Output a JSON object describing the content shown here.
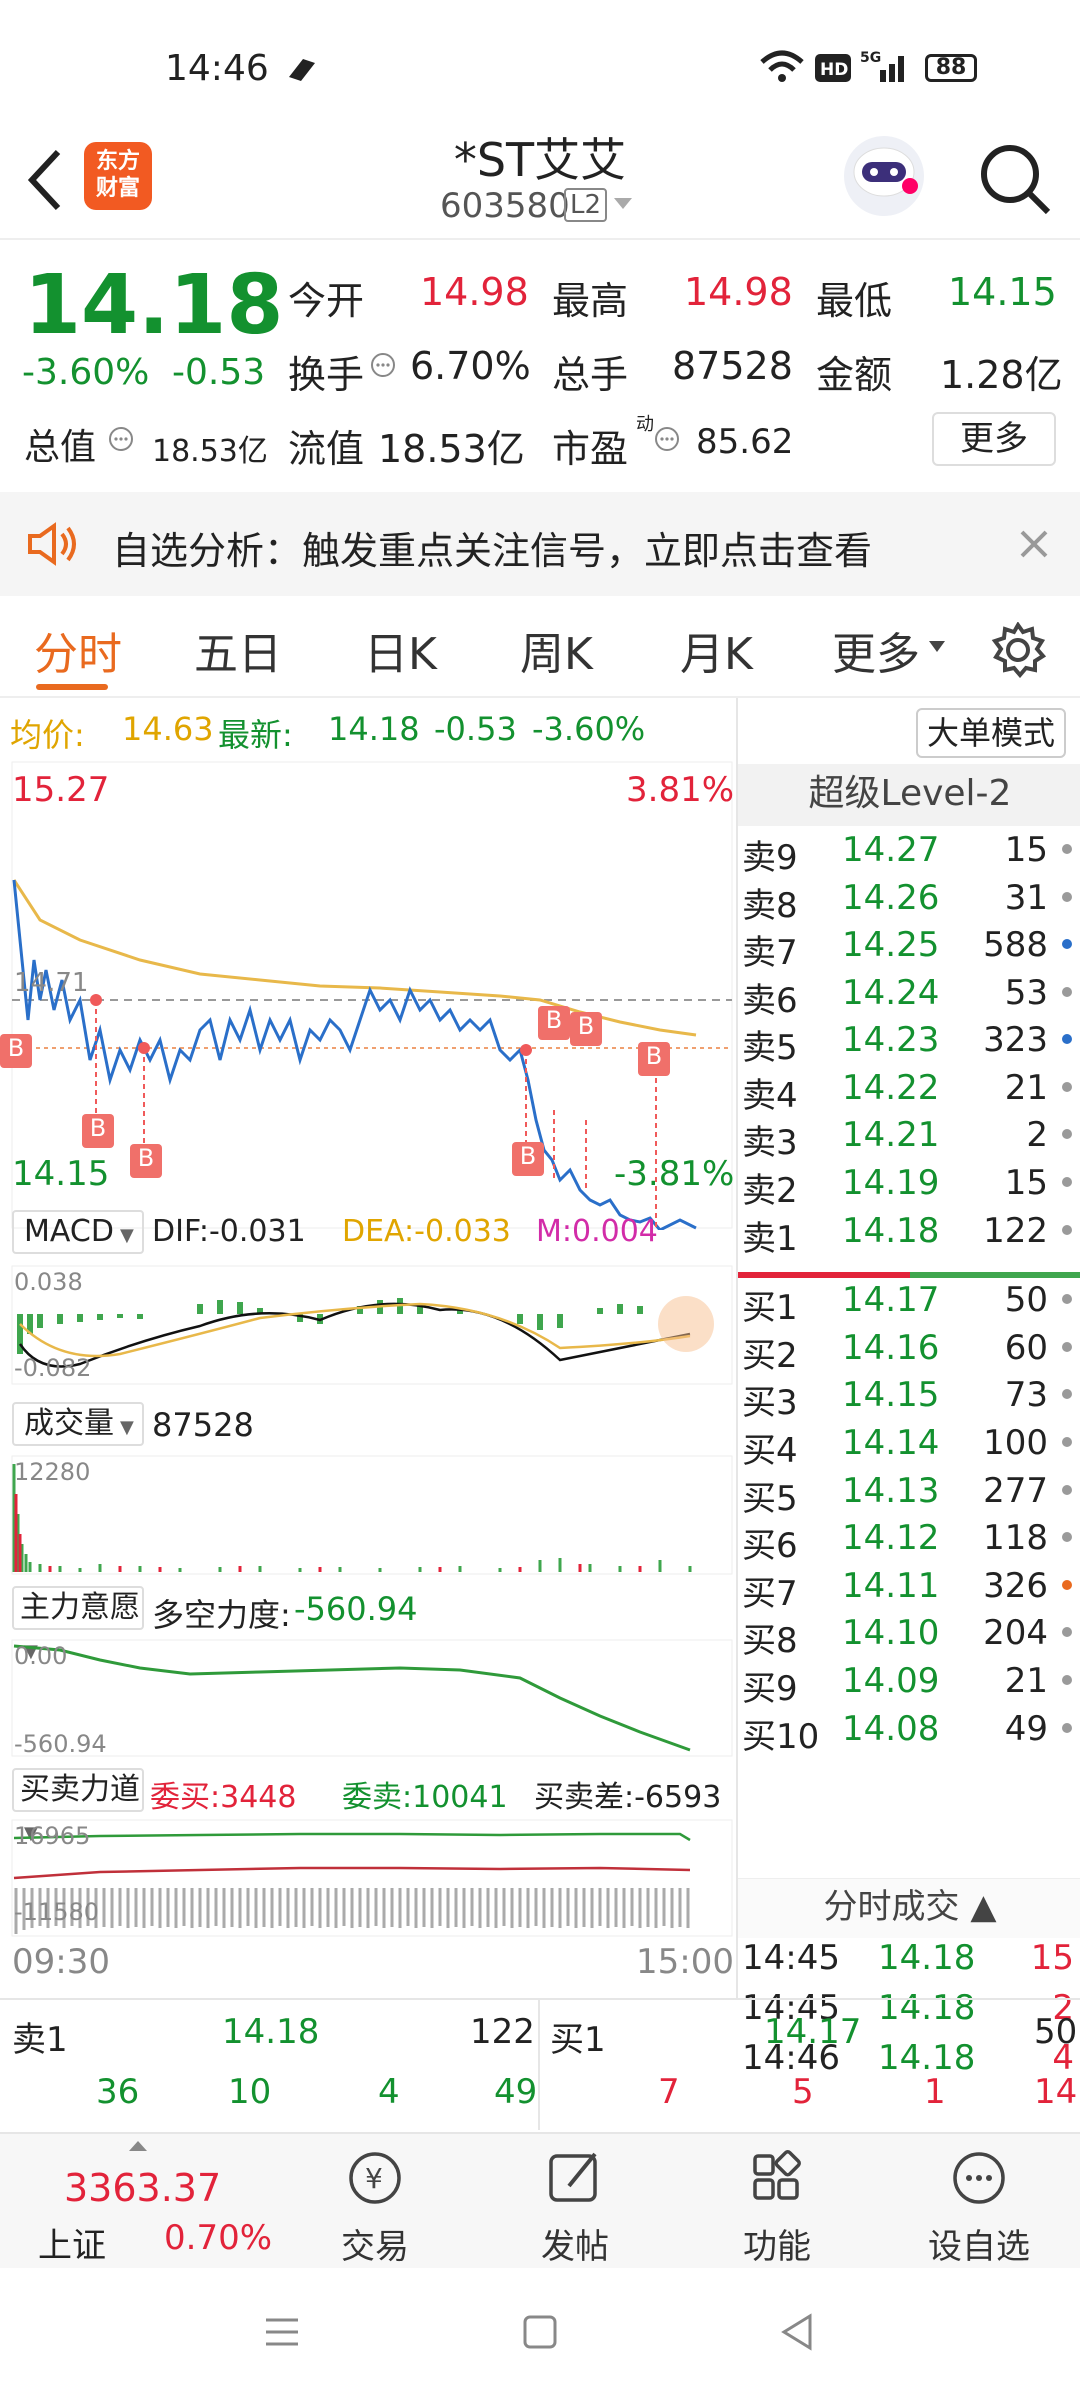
{
  "status_bar": {
    "time": "14:46",
    "battery": "88",
    "network": "5G"
  },
  "header": {
    "logo_line1": "东方",
    "logo_line2": "财富",
    "stock_name": "*ST艾艾",
    "stock_code": "603580",
    "level_badge": "L2"
  },
  "quote": {
    "price": "14.18",
    "change_pct": "-3.60%",
    "change_amt": "-0.53",
    "open_label": "今开",
    "open": "14.98",
    "high_label": "最高",
    "high": "14.98",
    "low_label": "最低",
    "low": "14.15",
    "turnover_label": "换手",
    "turnover": "6.70%",
    "volume_label": "总手",
    "volume": "87528",
    "amount_label": "金额",
    "amount": "1.28亿",
    "total_value_label": "总值",
    "total_value": "18.53亿",
    "float_value_label": "流值",
    "float_value": "18.53亿",
    "pe_label": "市盈",
    "pe_sup": "动",
    "pe": "85.62",
    "more_button": "更多"
  },
  "notice": {
    "text": "自选分析：触发重点关注信号，立即点击查看"
  },
  "tabs": [
    {
      "label": "分时"
    },
    {
      "label": "五日"
    },
    {
      "label": "日K"
    },
    {
      "label": "周K"
    },
    {
      "label": "月K"
    },
    {
      "label": "更多"
    }
  ],
  "chart_info": {
    "avg_label": "均价:",
    "avg": "14.63",
    "latest_label": "最新:",
    "latest": "14.18",
    "latest_change": "-0.53",
    "latest_pct": "-3.60%",
    "big_order_button": "大单模式"
  },
  "price_chart": {
    "top_price": "15.27",
    "top_pct": "3.81%",
    "bottom_price": "14.15",
    "bottom_pct": "-3.81%",
    "ref_price": "14.71"
  },
  "macd": {
    "label": "MACD",
    "dif": "DIF:-0.031",
    "dea": "DEA:-0.033",
    "m": "M:0.004",
    "top": "0.038",
    "bottom": "-0.082"
  },
  "volume_panel": {
    "label": "成交量",
    "value": "87528",
    "max": "12280"
  },
  "main_force": {
    "label": "主力意愿",
    "strength_label": "多空力度:",
    "strength": "-560.94",
    "top": "0.00",
    "bottom": "-560.94"
  },
  "buysell": {
    "label": "买卖力道",
    "buy": "委买:3448",
    "sell": "委卖:10041",
    "diff": "买卖差:-6593",
    "top": "16965",
    "bottom": "-11580"
  },
  "time_axis": {
    "start": "09:30",
    "end": "15:00"
  },
  "order_book": {
    "title": "超级Level-2",
    "sells": [
      {
        "label": "卖9",
        "price": "14.27",
        "vol": "15",
        "dot": "gray"
      },
      {
        "label": "卖8",
        "price": "14.26",
        "vol": "31",
        "dot": "gray"
      },
      {
        "label": "卖7",
        "price": "14.25",
        "vol": "588",
        "dot": "blue"
      },
      {
        "label": "卖6",
        "price": "14.24",
        "vol": "53",
        "dot": "gray"
      },
      {
        "label": "卖5",
        "price": "14.23",
        "vol": "323",
        "dot": "blue"
      },
      {
        "label": "卖4",
        "price": "14.22",
        "vol": "21",
        "dot": "gray"
      },
      {
        "label": "卖3",
        "price": "14.21",
        "vol": "2",
        "dot": "gray"
      },
      {
        "label": "卖2",
        "price": "14.19",
        "vol": "15",
        "dot": "gray"
      },
      {
        "label": "卖1",
        "price": "14.18",
        "vol": "122",
        "dot": "gray"
      }
    ],
    "buys": [
      {
        "label": "买1",
        "price": "14.17",
        "vol": "50",
        "dot": "gray"
      },
      {
        "label": "买2",
        "price": "14.16",
        "vol": "60",
        "dot": "gray"
      },
      {
        "label": "买3",
        "price": "14.15",
        "vol": "73",
        "dot": "gray"
      },
      {
        "label": "买4",
        "price": "14.14",
        "vol": "100",
        "dot": "gray"
      },
      {
        "label": "买5",
        "price": "14.13",
        "vol": "277",
        "dot": "gray"
      },
      {
        "label": "买6",
        "price": "14.12",
        "vol": "118",
        "dot": "gray"
      },
      {
        "label": "买7",
        "price": "14.11",
        "vol": "326",
        "dot": "orange"
      },
      {
        "label": "买8",
        "price": "14.10",
        "vol": "204",
        "dot": "gray"
      },
      {
        "label": "买9",
        "price": "14.09",
        "vol": "21",
        "dot": "gray"
      },
      {
        "label": "买10",
        "price": "14.08",
        "vol": "49",
        "dot": "gray"
      }
    ],
    "trades_title": "分时成交",
    "trades": [
      {
        "time": "14:45",
        "price": "14.18",
        "vol": "15"
      },
      {
        "time": "14:45",
        "price": "14.18",
        "vol": "2"
      },
      {
        "time": "14:46",
        "price": "14.18",
        "vol": "4"
      }
    ]
  },
  "tickers": {
    "sell_label": "卖1",
    "sell_price": "14.18",
    "sell_vol": "122",
    "buy_label": "买1",
    "buy_price": "14.17",
    "buy_vol": "50",
    "sell_row": [
      "36",
      "10",
      "4",
      "49"
    ],
    "buy_row": [
      "7",
      "5",
      "1",
      "14"
    ]
  },
  "bottom_nav": {
    "index_value": "3363.37",
    "index_name": "上证",
    "index_pct": "0.70%",
    "trade": "交易",
    "post": "发帖",
    "function": "功能",
    "add_watch": "设自选"
  }
}
